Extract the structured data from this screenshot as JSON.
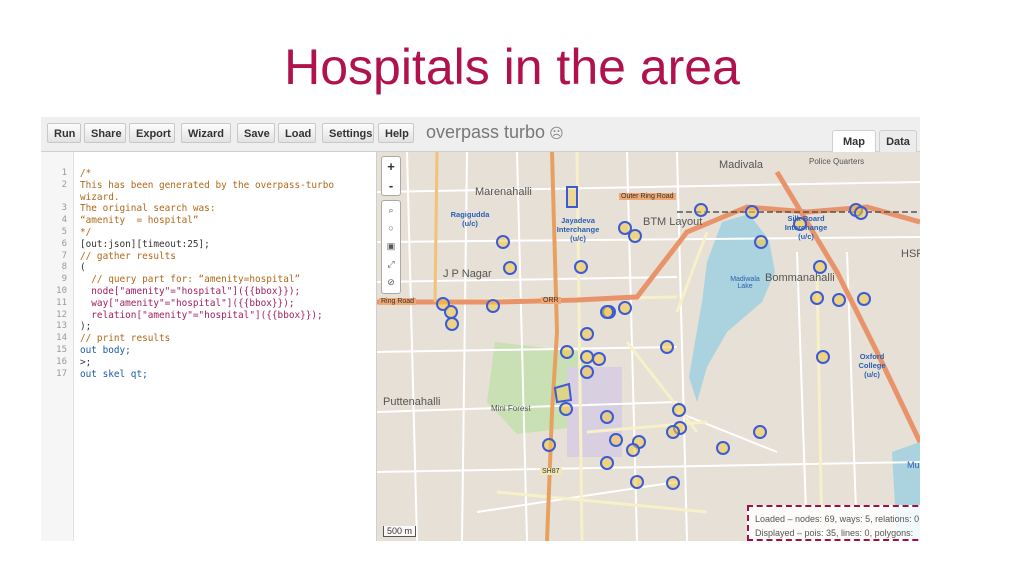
{
  "slide": {
    "title": "Hospitals in the area"
  },
  "toolbar": {
    "buttons": [
      "Run",
      "Share",
      "Export",
      "Wizard",
      "Save",
      "Load",
      "Settings",
      "Help"
    ],
    "app_title": "overpass turbo",
    "tabs": [
      "Map",
      "Data"
    ]
  },
  "editor": {
    "lines": [
      {
        "n": "1",
        "text": "/*",
        "style": "comment"
      },
      {
        "n": "2",
        "text": "This has been generated by the overpass-turbo",
        "style": "comment"
      },
      {
        "n": "",
        "text": "wizard.",
        "style": "comment"
      },
      {
        "n": "3",
        "text": "The original search was:",
        "style": "comment"
      },
      {
        "n": "4",
        "text": "“amenity  = hospital”",
        "style": "comment"
      },
      {
        "n": "5",
        "text": "*/",
        "style": "comment"
      },
      {
        "n": "6",
        "text": "[out:json][timeout:25];",
        "style": "plain"
      },
      {
        "n": "7",
        "text": "// gather results",
        "style": "comment"
      },
      {
        "n": "8",
        "text": "(",
        "style": "plain"
      },
      {
        "n": "9",
        "text": "  // query part for: “amenity=hospital”",
        "style": "comment"
      },
      {
        "n": "10",
        "text": "  node[\"amenity\"=\"hospital\"]({{bbox}});",
        "style": "str"
      },
      {
        "n": "11",
        "text": "  way[\"amenity\"=\"hospital\"]({{bbox}});",
        "style": "str"
      },
      {
        "n": "12",
        "text": "  relation[\"amenity\"=\"hospital\"]({{bbox}});",
        "style": "str"
      },
      {
        "n": "13",
        "text": ");",
        "style": "plain"
      },
      {
        "n": "14",
        "text": "// print results",
        "style": "comment"
      },
      {
        "n": "15",
        "text": "out body;",
        "style": "kw"
      },
      {
        "n": "16",
        "text": ">;",
        "style": "plain"
      },
      {
        "n": "17",
        "text": "out skel qt;",
        "style": "kw"
      }
    ]
  },
  "map": {
    "zoom_in": "+",
    "zoom_out": "-",
    "scale": "500 m",
    "labels": {
      "madivala": "Madivala",
      "police_quarters": "Police Quarters",
      "marenahalli": "Marenahalli",
      "rajigudda": "Ragigudda (u/c)",
      "jayadeva": "Jayadeva Interchange (u/c)",
      "btm": "BTM Layout",
      "silk_board": "Silk Board Interchange (u/c)",
      "jp_nagar": "J P Nagar",
      "bommanahalli": "Bommanahalli",
      "madiwala_lake": "Madiwala Lake",
      "oxford": "Oxford College (u/c)",
      "puttenahalli": "Puttenahalli",
      "mini_forest": "Mini Forest",
      "hsr": "HSR",
      "mu": "Mu",
      "sh87": "SH87",
      "outer_ring_road": "Outer Ring Road",
      "orr": "ORR",
      "ring_road": "Ring Road"
    },
    "stats": {
      "loaded": "Loaded – nodes: 69, ways: 5, relations: 0",
      "displayed": "Displayed – pois: 35, lines: 0, polygons: 5"
    },
    "colors": {
      "marker": "#3b5bd6",
      "marker_fill": "#f5c842",
      "road_major": "#e8936a",
      "water": "#aad3df"
    }
  }
}
